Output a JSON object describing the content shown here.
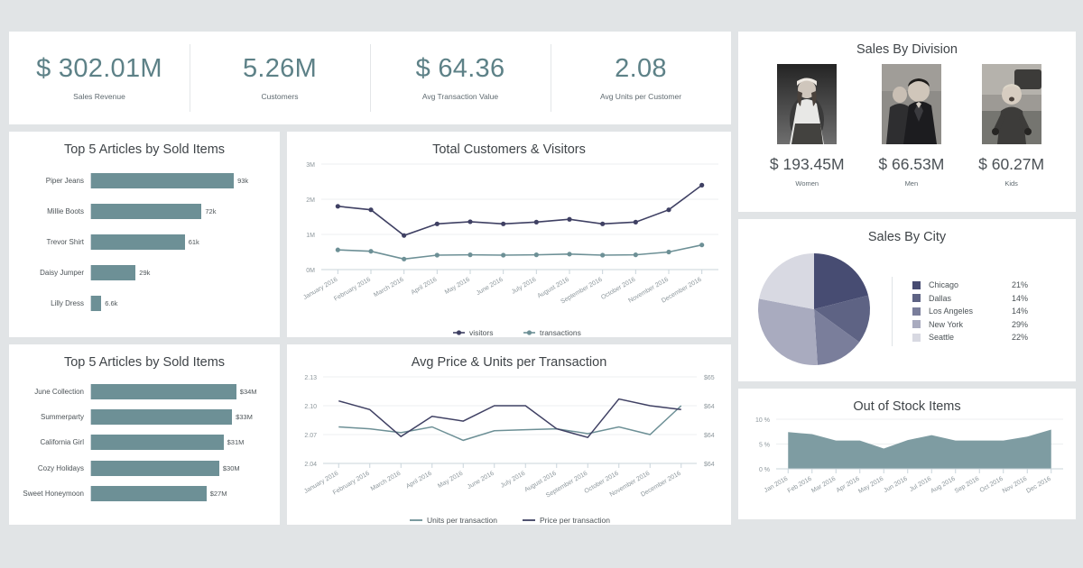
{
  "kpis": [
    {
      "value": "$ 302.01M",
      "label": "Sales Revenue"
    },
    {
      "value": "5.26M",
      "label": "Customers"
    },
    {
      "value": "$ 64.36",
      "label": "Avg Transaction Value"
    },
    {
      "value": "2.08",
      "label": "Avg Units per Customer"
    }
  ],
  "colors": {
    "teal": "#6d9096",
    "navy": "#3f4063",
    "kpi": "#5d8187",
    "background": "#e1e4e6",
    "card": "#ffffff",
    "pie": [
      "#474c72",
      "#5e6384",
      "#7a7e9b",
      "#a9abbf",
      "#d8d9e2"
    ]
  },
  "top_articles_units": {
    "chart_data": {
      "type": "bar",
      "title": "Top 5 Articles by Sold Items",
      "categories": [
        "Piper Jeans",
        "Millie Boots",
        "Trevor Shirt",
        "Daisy Jumper",
        "Lilly Dress"
      ],
      "values": [
        93,
        72,
        61,
        29,
        6.6
      ],
      "labels": [
        "93k",
        "72k",
        "61k",
        "29k",
        "6.6k"
      ],
      "xlabel": "",
      "ylabel": "",
      "xlim": [
        0,
        100
      ],
      "grid": false
    }
  },
  "top_articles_revenue": {
    "chart_data": {
      "type": "bar",
      "title": "Top 5 Articles by Sold Items",
      "categories": [
        "June Collection",
        "Summerparty",
        "California Girl",
        "Cozy Holidays",
        "Sweet Honeymoon"
      ],
      "values": [
        34,
        33,
        31,
        30,
        27
      ],
      "labels": [
        "$34M",
        "$33M",
        "$31M",
        "$30M",
        "$27M"
      ],
      "xlabel": "",
      "ylabel": "",
      "xlim": [
        0,
        37
      ],
      "grid": false
    }
  },
  "customers_visitors": {
    "chart_data": {
      "type": "line",
      "title": "Total Customers & Visitors",
      "categories": [
        "January 2016",
        "February 2016",
        "March 2016",
        "April 2016",
        "May 2016",
        "June 2016",
        "July 2016",
        "August 2016",
        "September 2016",
        "October 2016",
        "November 2016",
        "December 2016"
      ],
      "series": [
        {
          "name": "visitors",
          "values": [
            1.8,
            1.7,
            0.97,
            1.3,
            1.36,
            1.3,
            1.35,
            1.43,
            1.3,
            1.35,
            1.7,
            2.4
          ]
        },
        {
          "name": "transactions",
          "values": [
            0.56,
            0.52,
            0.3,
            0.41,
            0.42,
            0.41,
            0.42,
            0.44,
            0.41,
            0.42,
            0.5,
            0.7
          ]
        }
      ],
      "ylim": [
        0,
        3
      ],
      "yticks": [
        "0M",
        "1M",
        "2M",
        "3M"
      ],
      "ylabel": "",
      "xlabel": "",
      "grid": true,
      "legend": "bottom"
    }
  },
  "price_units": {
    "chart_data": {
      "type": "line",
      "title": "Avg Price & Units per Transaction",
      "categories": [
        "January 2016",
        "February 2016",
        "March 2016",
        "April 2016",
        "May 2016",
        "June 2016",
        "July 2016",
        "August 2016",
        "September 2016",
        "October 2016",
        "November 2016",
        "December 2016"
      ],
      "series": [
        {
          "name": "Units per transaction",
          "values": [
            2.078,
            2.076,
            2.072,
            2.078,
            2.064,
            2.074,
            2.075,
            2.076,
            2.071,
            2.078,
            2.07,
            2.1
          ],
          "axis": "left"
        },
        {
          "name": "Price per transaction",
          "values": [
            2.105,
            2.096,
            2.068,
            2.089,
            2.084,
            2.1,
            2.1,
            2.076,
            2.067,
            2.107,
            2.1,
            2.096
          ],
          "axis": "right"
        }
      ],
      "ylim": [
        2.04,
        2.13
      ],
      "yticks_left": [
        "2.04",
        "2.07",
        "2.10",
        "2.13"
      ],
      "yticks_right": [
        "$64",
        "$64",
        "$64",
        "$65"
      ],
      "grid": true,
      "legend": "bottom"
    }
  },
  "sales_by_division": {
    "title": "Sales By Division",
    "items": [
      {
        "value": "$ 193.45M",
        "label": "Women"
      },
      {
        "value": "$ 66.53M",
        "label": "Men"
      },
      {
        "value": "$ 60.27M",
        "label": "Kids"
      }
    ]
  },
  "sales_by_city": {
    "chart_data": {
      "type": "pie",
      "title": "Sales By City",
      "categories": [
        "Chicago",
        "Dallas",
        "Los Angeles",
        "New York",
        "Seattle"
      ],
      "values": [
        21,
        14,
        14,
        29,
        22
      ],
      "labels": [
        "21%",
        "14%",
        "14%",
        "29%",
        "22%"
      ],
      "legend": "right"
    }
  },
  "out_of_stock": {
    "chart_data": {
      "type": "area",
      "title": "Out of Stock Items",
      "categories": [
        "Jan 2016",
        "Feb 2016",
        "Mar 2016",
        "Apr 2016",
        "May 2016",
        "Jun 2016",
        "Jul 2016",
        "Aug 2016",
        "Sep 2016",
        "Oct 2016",
        "Nov 2016",
        "Dec 2016"
      ],
      "values": [
        7.4,
        7.0,
        5.7,
        5.7,
        4.1,
        5.8,
        6.8,
        5.7,
        5.7,
        5.7,
        6.5,
        7.9
      ],
      "ylim": [
        0,
        10
      ],
      "yticks": [
        "0 %",
        "5 %",
        "10 %"
      ],
      "ylabel": "",
      "xlabel": "",
      "grid": true
    }
  }
}
